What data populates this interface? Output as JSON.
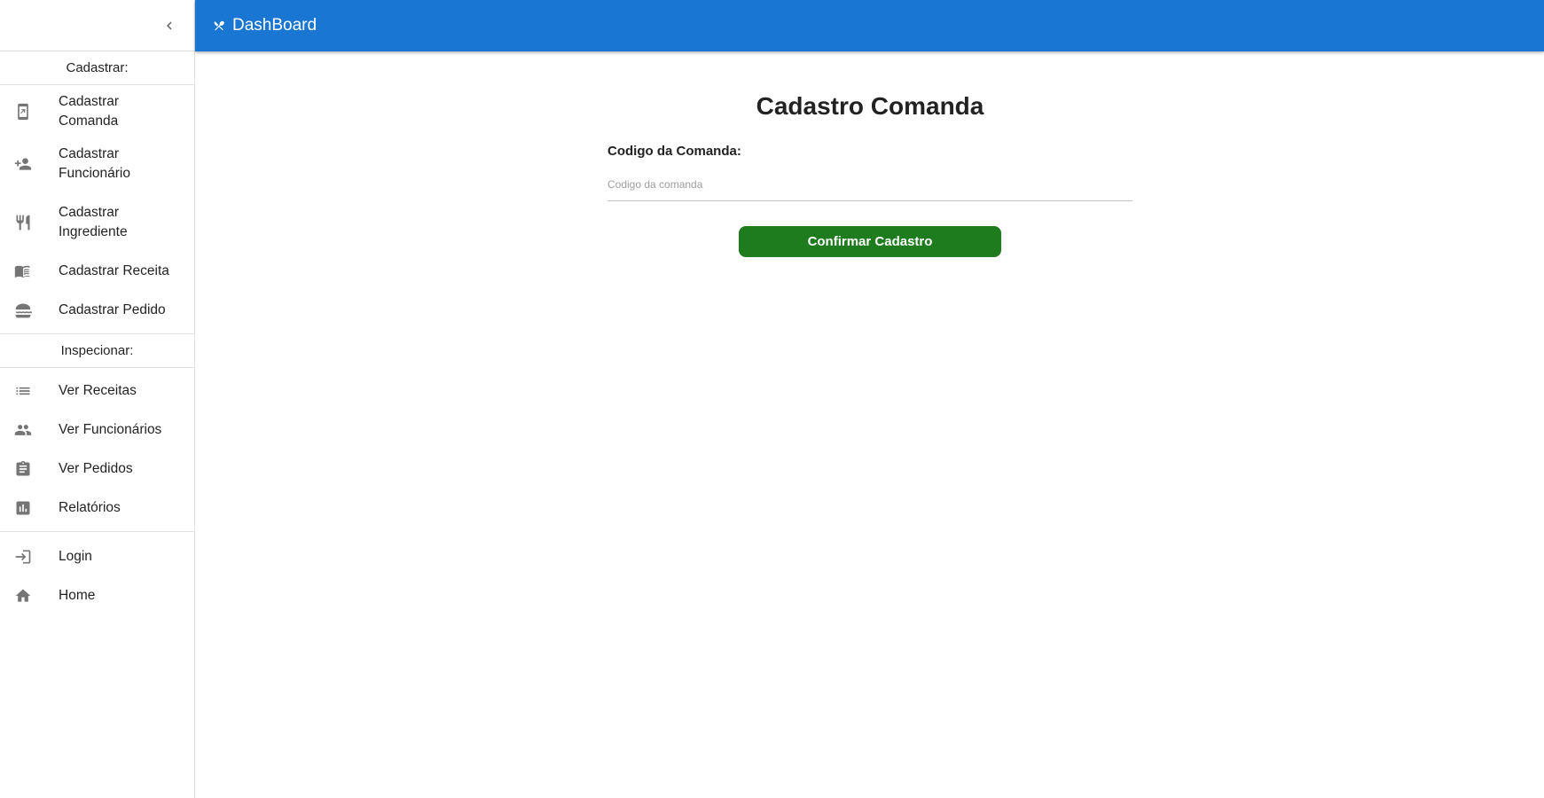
{
  "appbar": {
    "title": "DashBoard",
    "icon": "utensils-crossed-icon",
    "color": "#1976d2"
  },
  "sidebar": {
    "collapse_icon": "chevron-left-icon",
    "sections": [
      {
        "header": "Cadastrar:",
        "items": [
          {
            "label": "Cadastrar Comanda",
            "icon": "tablet-arrow-icon"
          },
          {
            "label": "Cadastrar\nFuncionário",
            "icon": "person-add-icon"
          },
          {
            "label": "Cadastrar\nIngrediente",
            "icon": "restaurant-icon"
          },
          {
            "label": "Cadastrar Receita",
            "icon": "menu-book-icon"
          },
          {
            "label": "Cadastrar Pedido",
            "icon": "lunch-dining-icon"
          }
        ]
      },
      {
        "header": "Inspecionar:",
        "items": [
          {
            "label": "Ver Receitas",
            "icon": "list-icon"
          },
          {
            "label": "Ver Funcionários",
            "icon": "people-icon"
          },
          {
            "label": "Ver Pedidos",
            "icon": "assignment-icon"
          },
          {
            "label": "Relatórios",
            "icon": "assessment-icon"
          }
        ]
      },
      {
        "header": "",
        "items": [
          {
            "label": "Login",
            "icon": "login-icon"
          },
          {
            "label": "Home",
            "icon": "home-icon"
          }
        ]
      }
    ]
  },
  "main": {
    "title": "Cadastro Comanda",
    "field_label": "Codigo da Comanda:",
    "field_placeholder": "Codigo da comanda",
    "field_value": "",
    "confirm_label": "Confirmar Cadastro",
    "confirm_color": "#1e7b1e"
  }
}
